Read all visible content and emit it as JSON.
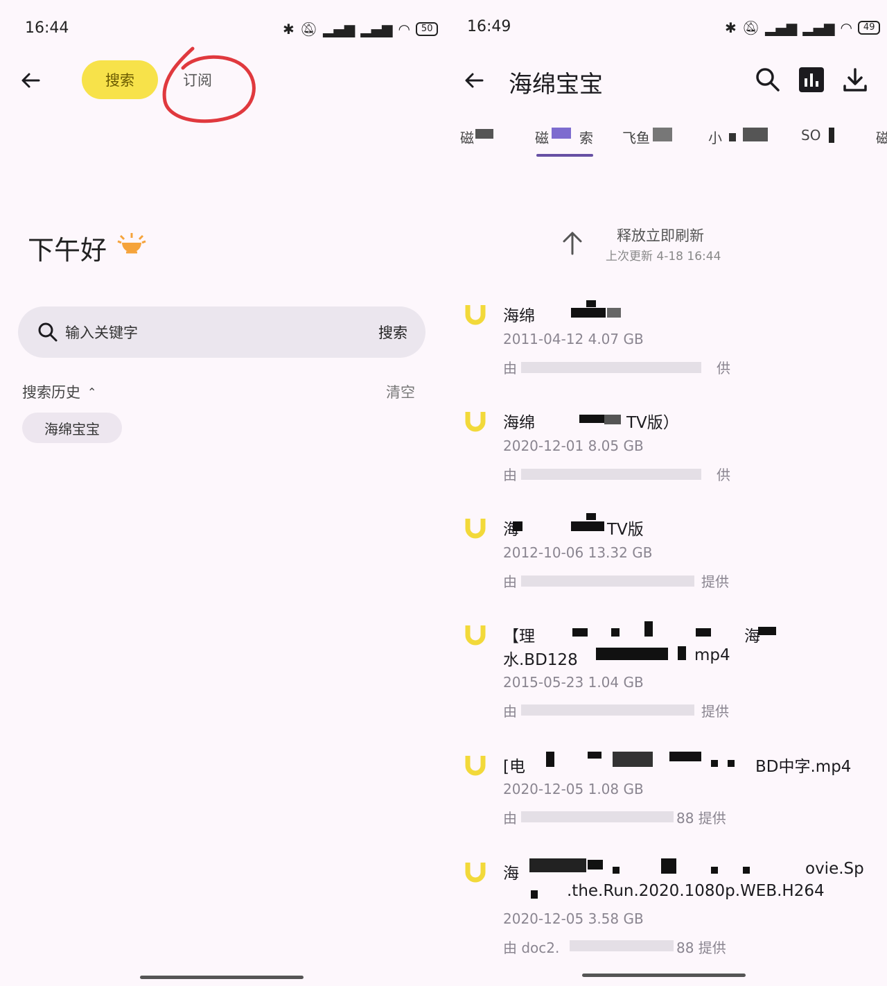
{
  "left": {
    "status": {
      "time": "16:44",
      "battery": "50"
    },
    "header": {
      "tab_search": "搜索",
      "tab_subscribe": "订阅"
    },
    "greeting": "下午好",
    "search": {
      "placeholder": "输入关键字",
      "button": "搜索"
    },
    "history": {
      "title": "搜索历史",
      "clear": "清空",
      "items": [
        "海绵宝宝"
      ]
    }
  },
  "right": {
    "status": {
      "time": "16:49",
      "battery": "49"
    },
    "header": {
      "title": "海绵宝宝"
    },
    "tabs": [
      "磁",
      "磁",
      "索",
      "飞鱼",
      "小",
      "SO",
      "磁"
    ],
    "refresh": {
      "label": "释放立即刷新",
      "last_update": "上次更新 4-18 16:44"
    },
    "results": [
      {
        "title": "海绵",
        "title_tail": "",
        "date_size": "2011-04-12 4.07 GB",
        "src_prefix": "由",
        "src_suffix": "供"
      },
      {
        "title": "海绵",
        "title_tail": "TV版）",
        "date_size": "2020-12-01 8.05 GB",
        "src_prefix": "由",
        "src_suffix": "供"
      },
      {
        "title": "海",
        "title_tail": "TV版",
        "date_size": "2012-10-06 13.32 GB",
        "src_prefix": "由",
        "src_suffix": "提供"
      },
      {
        "title": "【理",
        "title_tail": "海",
        "title2": "水.BD128",
        "title2_tail": "mp4",
        "date_size": "2015-05-23  1.04 GB",
        "src_prefix": "由",
        "src_suffix": "提供"
      },
      {
        "title": "[电",
        "title_tail": "BD中字.mp4",
        "date_size": "2020-12-05  1.08 GB",
        "src_prefix": "由",
        "src_suffix": "88 提供"
      },
      {
        "title": "海",
        "title_tail": "ovie.Sp",
        "title2": ".the.Run.2020.1080p.WEB.H264",
        "date_size": "2020-12-05  3.58 GB",
        "src_prefix": "由 doc2.",
        "src_suffix": "88 提供"
      }
    ]
  },
  "colors": {
    "accent": "#6750a4",
    "pill": "#f7e24a",
    "annotation": "#e0393e",
    "u_icon": "#f2d93a"
  }
}
